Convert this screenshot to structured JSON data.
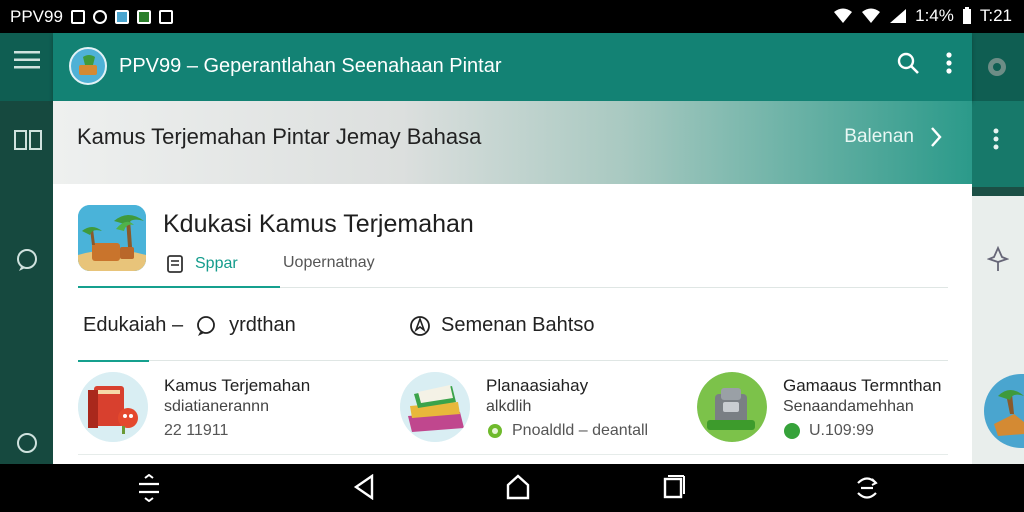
{
  "status_bar": {
    "carrier": "PPV99",
    "battery_text": "1:4%",
    "time": "T:21"
  },
  "app_bar": {
    "title": "PPV99 – Geperantlahan Seenahaan Pintar"
  },
  "banner": {
    "title": "Kamus Terjemahan Pintar Jemay Bahasa",
    "link_label": "Balenan"
  },
  "card": {
    "title": "Kdukasi Kamus Terjemahan",
    "tabs": [
      {
        "label": "Sppar"
      },
      {
        "label": "Uopernatnay"
      }
    ]
  },
  "filters": {
    "left_label": "Edukaiah –",
    "left_sub": "yrdthan",
    "right_label": "Semenan Bahtso"
  },
  "items": [
    {
      "title": "Kamus Terjemahan",
      "subtitle": "sdiatianerannn",
      "meta": "22 11911"
    },
    {
      "title": "Planaasiahay",
      "subtitle": "alkdlih",
      "meta": "Pnoaldld – deantall"
    },
    {
      "title": "Gamaaus Termnthan",
      "subtitle": "Senaandamehhan",
      "meta": "U.109:99"
    }
  ],
  "colors": {
    "primary": "#138274",
    "accent": "#15a08e",
    "status_bar": "#000000"
  }
}
